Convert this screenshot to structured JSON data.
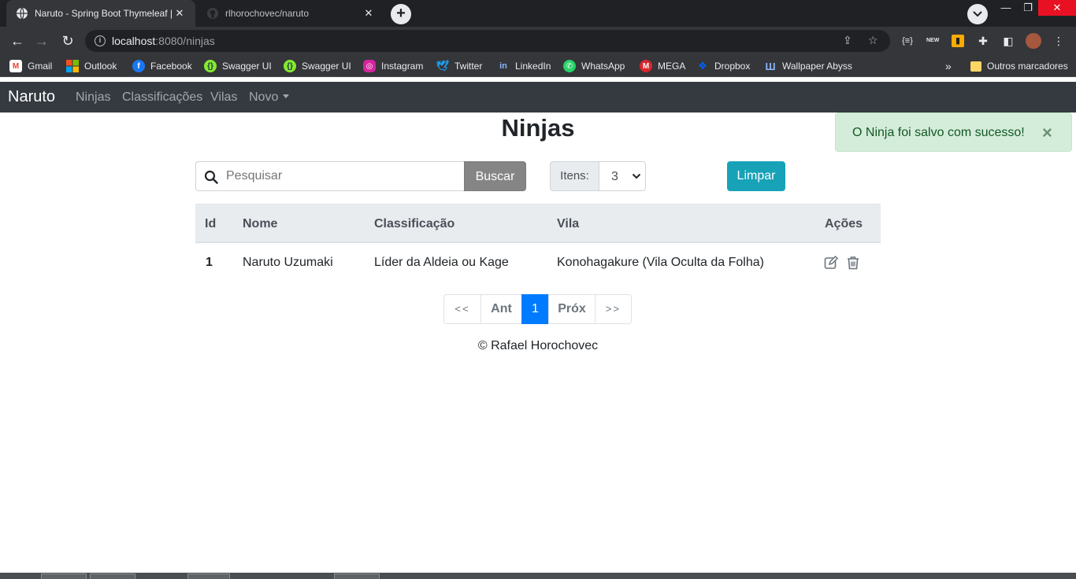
{
  "browser": {
    "tabs": [
      {
        "title": "Naruto - Spring Boot Thymeleaf | ",
        "icon": "globe-icon",
        "active": true
      },
      {
        "title": "rlhorochovec/naruto",
        "icon": "github-icon",
        "active": false
      }
    ],
    "url_host": "localhost",
    "url_path": ":8080/ninjas",
    "bookmarks": [
      {
        "label": "Gmail",
        "icon": "gmail-icon",
        "color": "#ea4335"
      },
      {
        "label": "Outlook",
        "icon": "microsoft-icon",
        "color": "#f25022"
      },
      {
        "label": "Facebook",
        "icon": "facebook-icon",
        "color": "#1877f2"
      },
      {
        "label": "Swagger UI",
        "icon": "swagger-icon",
        "color": "#85ea2d"
      },
      {
        "label": "Swagger UI",
        "icon": "swagger-icon",
        "color": "#85ea2d"
      },
      {
        "label": "Instagram",
        "icon": "instagram-icon",
        "color": "#d6249f"
      },
      {
        "label": "Twitter",
        "icon": "twitter-icon",
        "color": "#1da1f2"
      },
      {
        "label": "LinkedIn",
        "icon": "linkedin-icon",
        "color": "#0a66c2"
      },
      {
        "label": "WhatsApp",
        "icon": "whatsapp-icon",
        "color": "#25d366"
      },
      {
        "label": "MEGA",
        "icon": "mega-icon",
        "color": "#d9272e"
      },
      {
        "label": "Dropbox",
        "icon": "dropbox-icon",
        "color": "#0061ff"
      },
      {
        "label": "Wallpaper Abyss",
        "icon": "wallpaper-icon",
        "color": "#8ab4f8"
      }
    ],
    "more_bookmarks": "»",
    "other_bookmarks": "Outros marcadores"
  },
  "navbar": {
    "brand": "Naruto",
    "links": [
      "Ninjas",
      "Classificações",
      "Vilas",
      "Novo"
    ]
  },
  "alert": {
    "message": "O Ninja foi salvo com sucesso!",
    "close": "×"
  },
  "page": {
    "title": "Ninjas",
    "search_placeholder": "Pesquisar",
    "search_button": "Buscar",
    "items_label": "Itens:",
    "items_value": "3",
    "clear_button": "Limpar"
  },
  "table": {
    "headers": [
      "Id",
      "Nome",
      "Classificação",
      "Vila",
      "Ações"
    ],
    "rows": [
      {
        "id": "1",
        "nome": "Naruto Uzumaki",
        "classificacao": "Líder da Aldeia ou Kage",
        "vila": "Konohagakure (Vila Oculta da Folha)"
      }
    ]
  },
  "pagination": {
    "first": "<<",
    "prev": "Ant",
    "current": "1",
    "next": "Próx",
    "last": ">>"
  },
  "footer": {
    "text": "© Rafael Horochovec"
  },
  "colors": {
    "navbar_bg": "#343a40",
    "alert_bg": "#d4edda",
    "primary": "#007bff",
    "info": "#17a2b8",
    "secondary": "#858585"
  }
}
